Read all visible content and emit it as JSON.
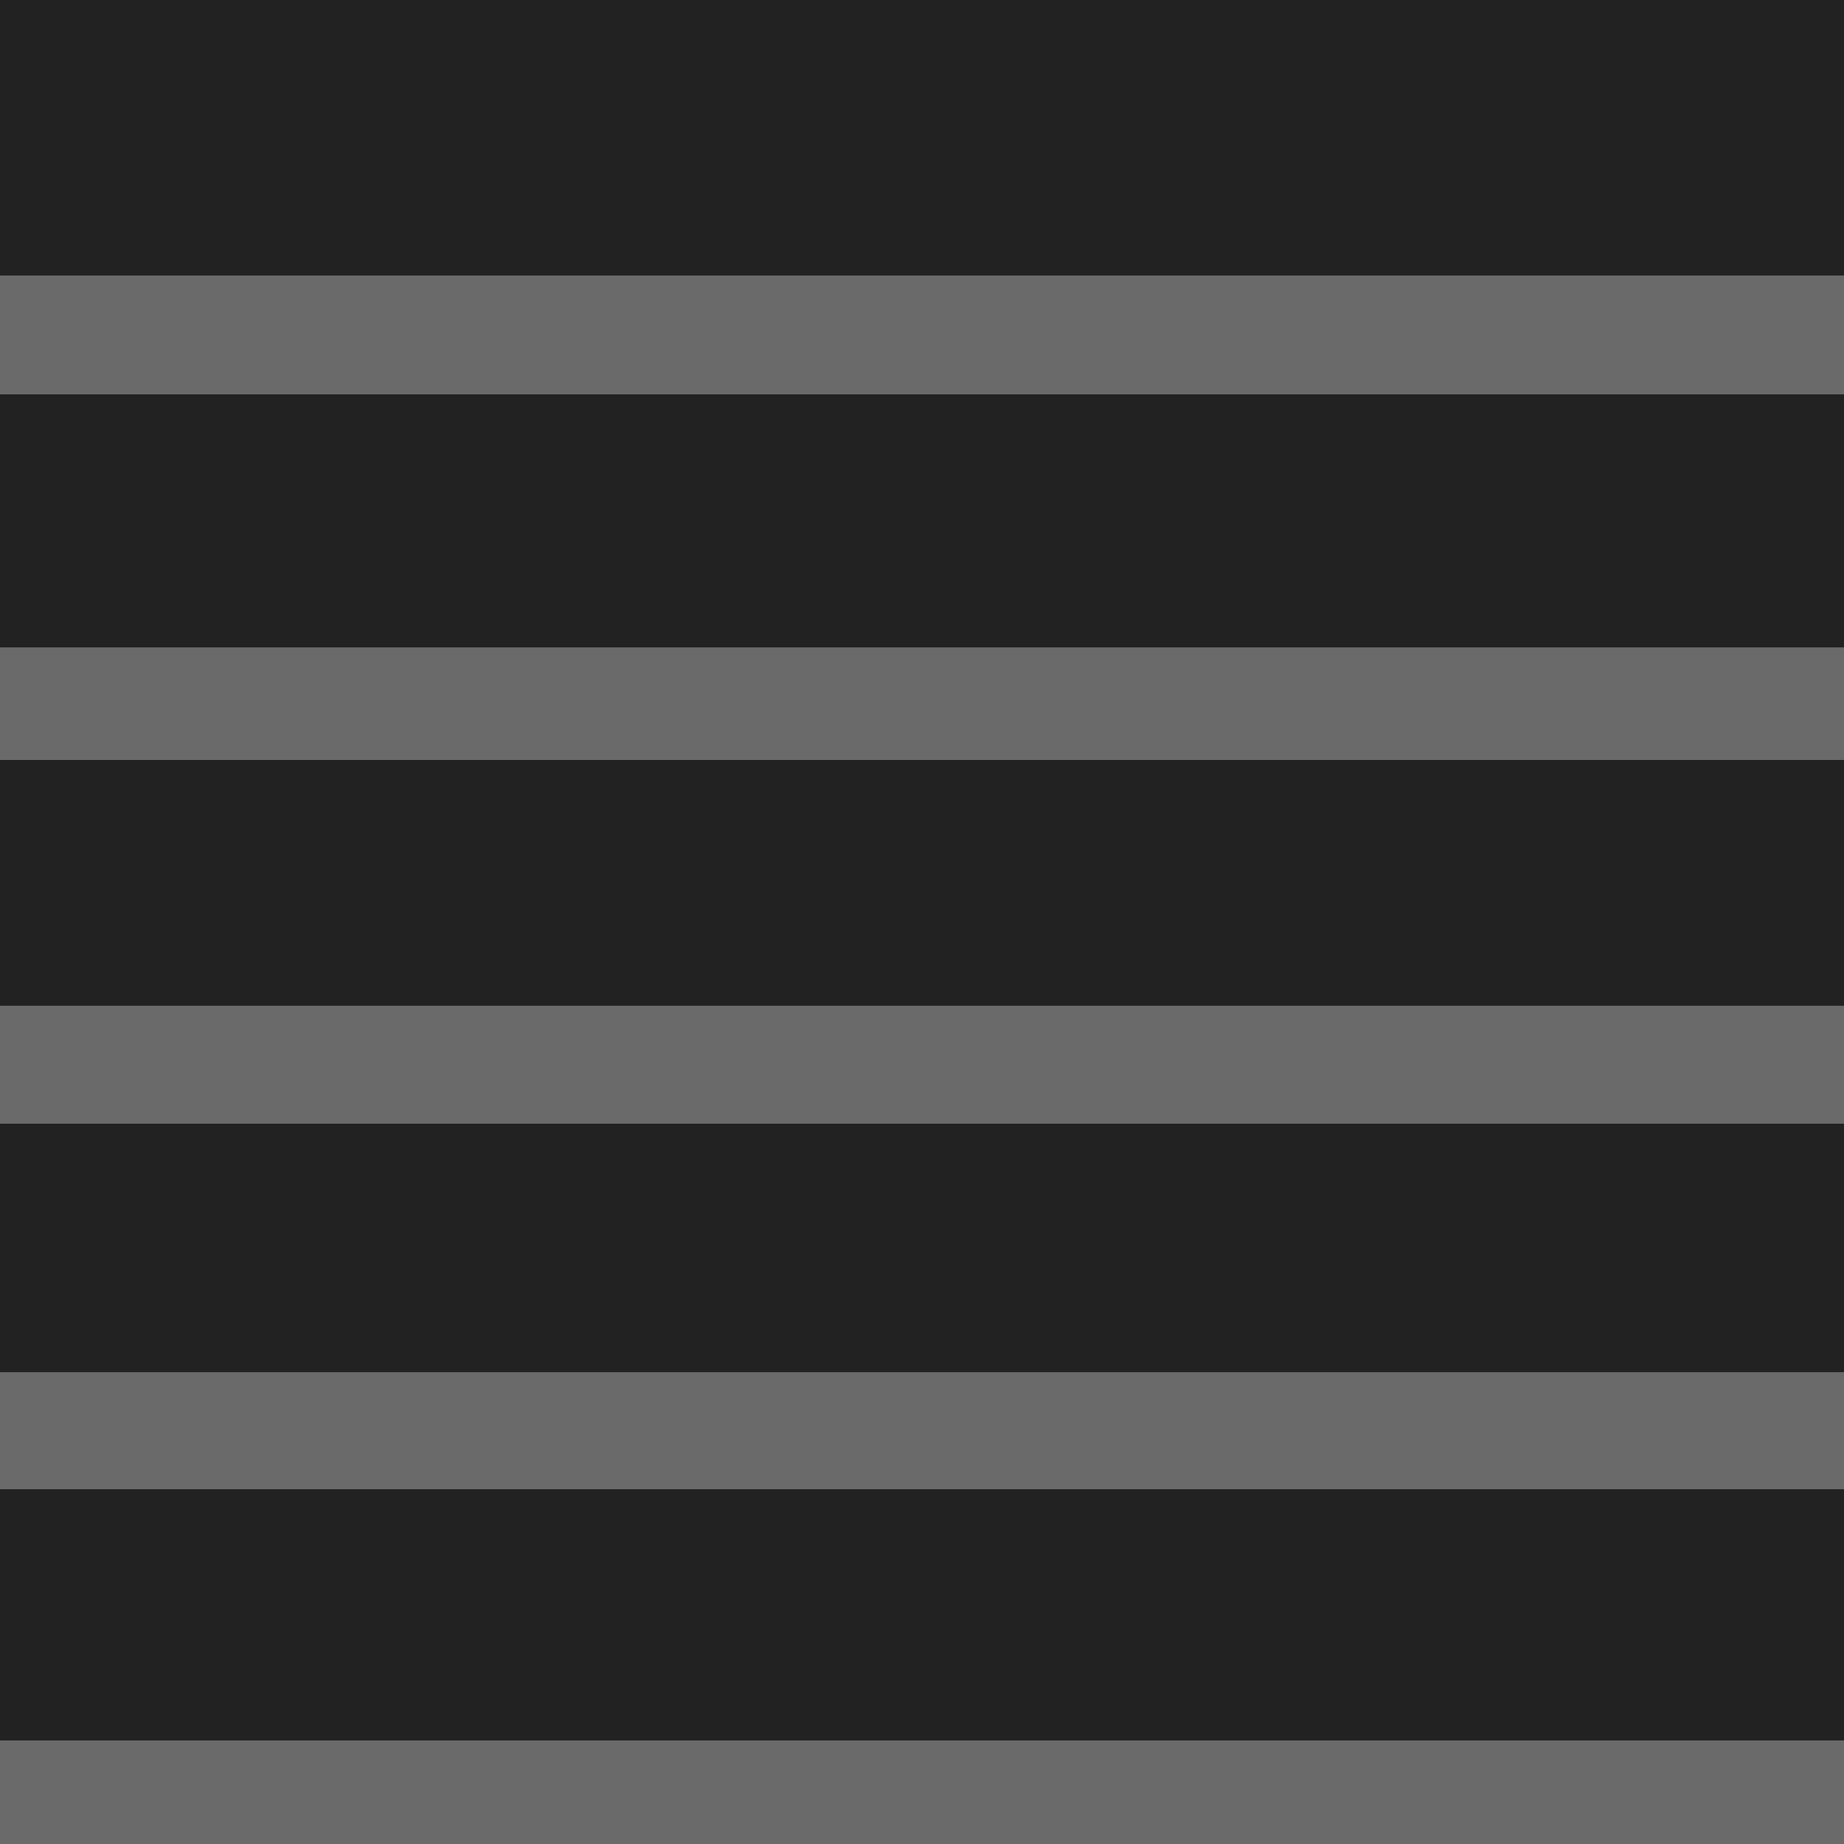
{
  "colors": {
    "panel": "#222222",
    "separator": "#6a6a6a"
  },
  "layout_pattern": "alternating-horizontal-bands",
  "bands": [
    {
      "kind": "panel"
    },
    {
      "kind": "separator"
    },
    {
      "kind": "panel"
    },
    {
      "kind": "separator"
    },
    {
      "kind": "panel"
    },
    {
      "kind": "separator"
    },
    {
      "kind": "panel"
    },
    {
      "kind": "separator"
    },
    {
      "kind": "panel"
    },
    {
      "kind": "separator"
    }
  ]
}
